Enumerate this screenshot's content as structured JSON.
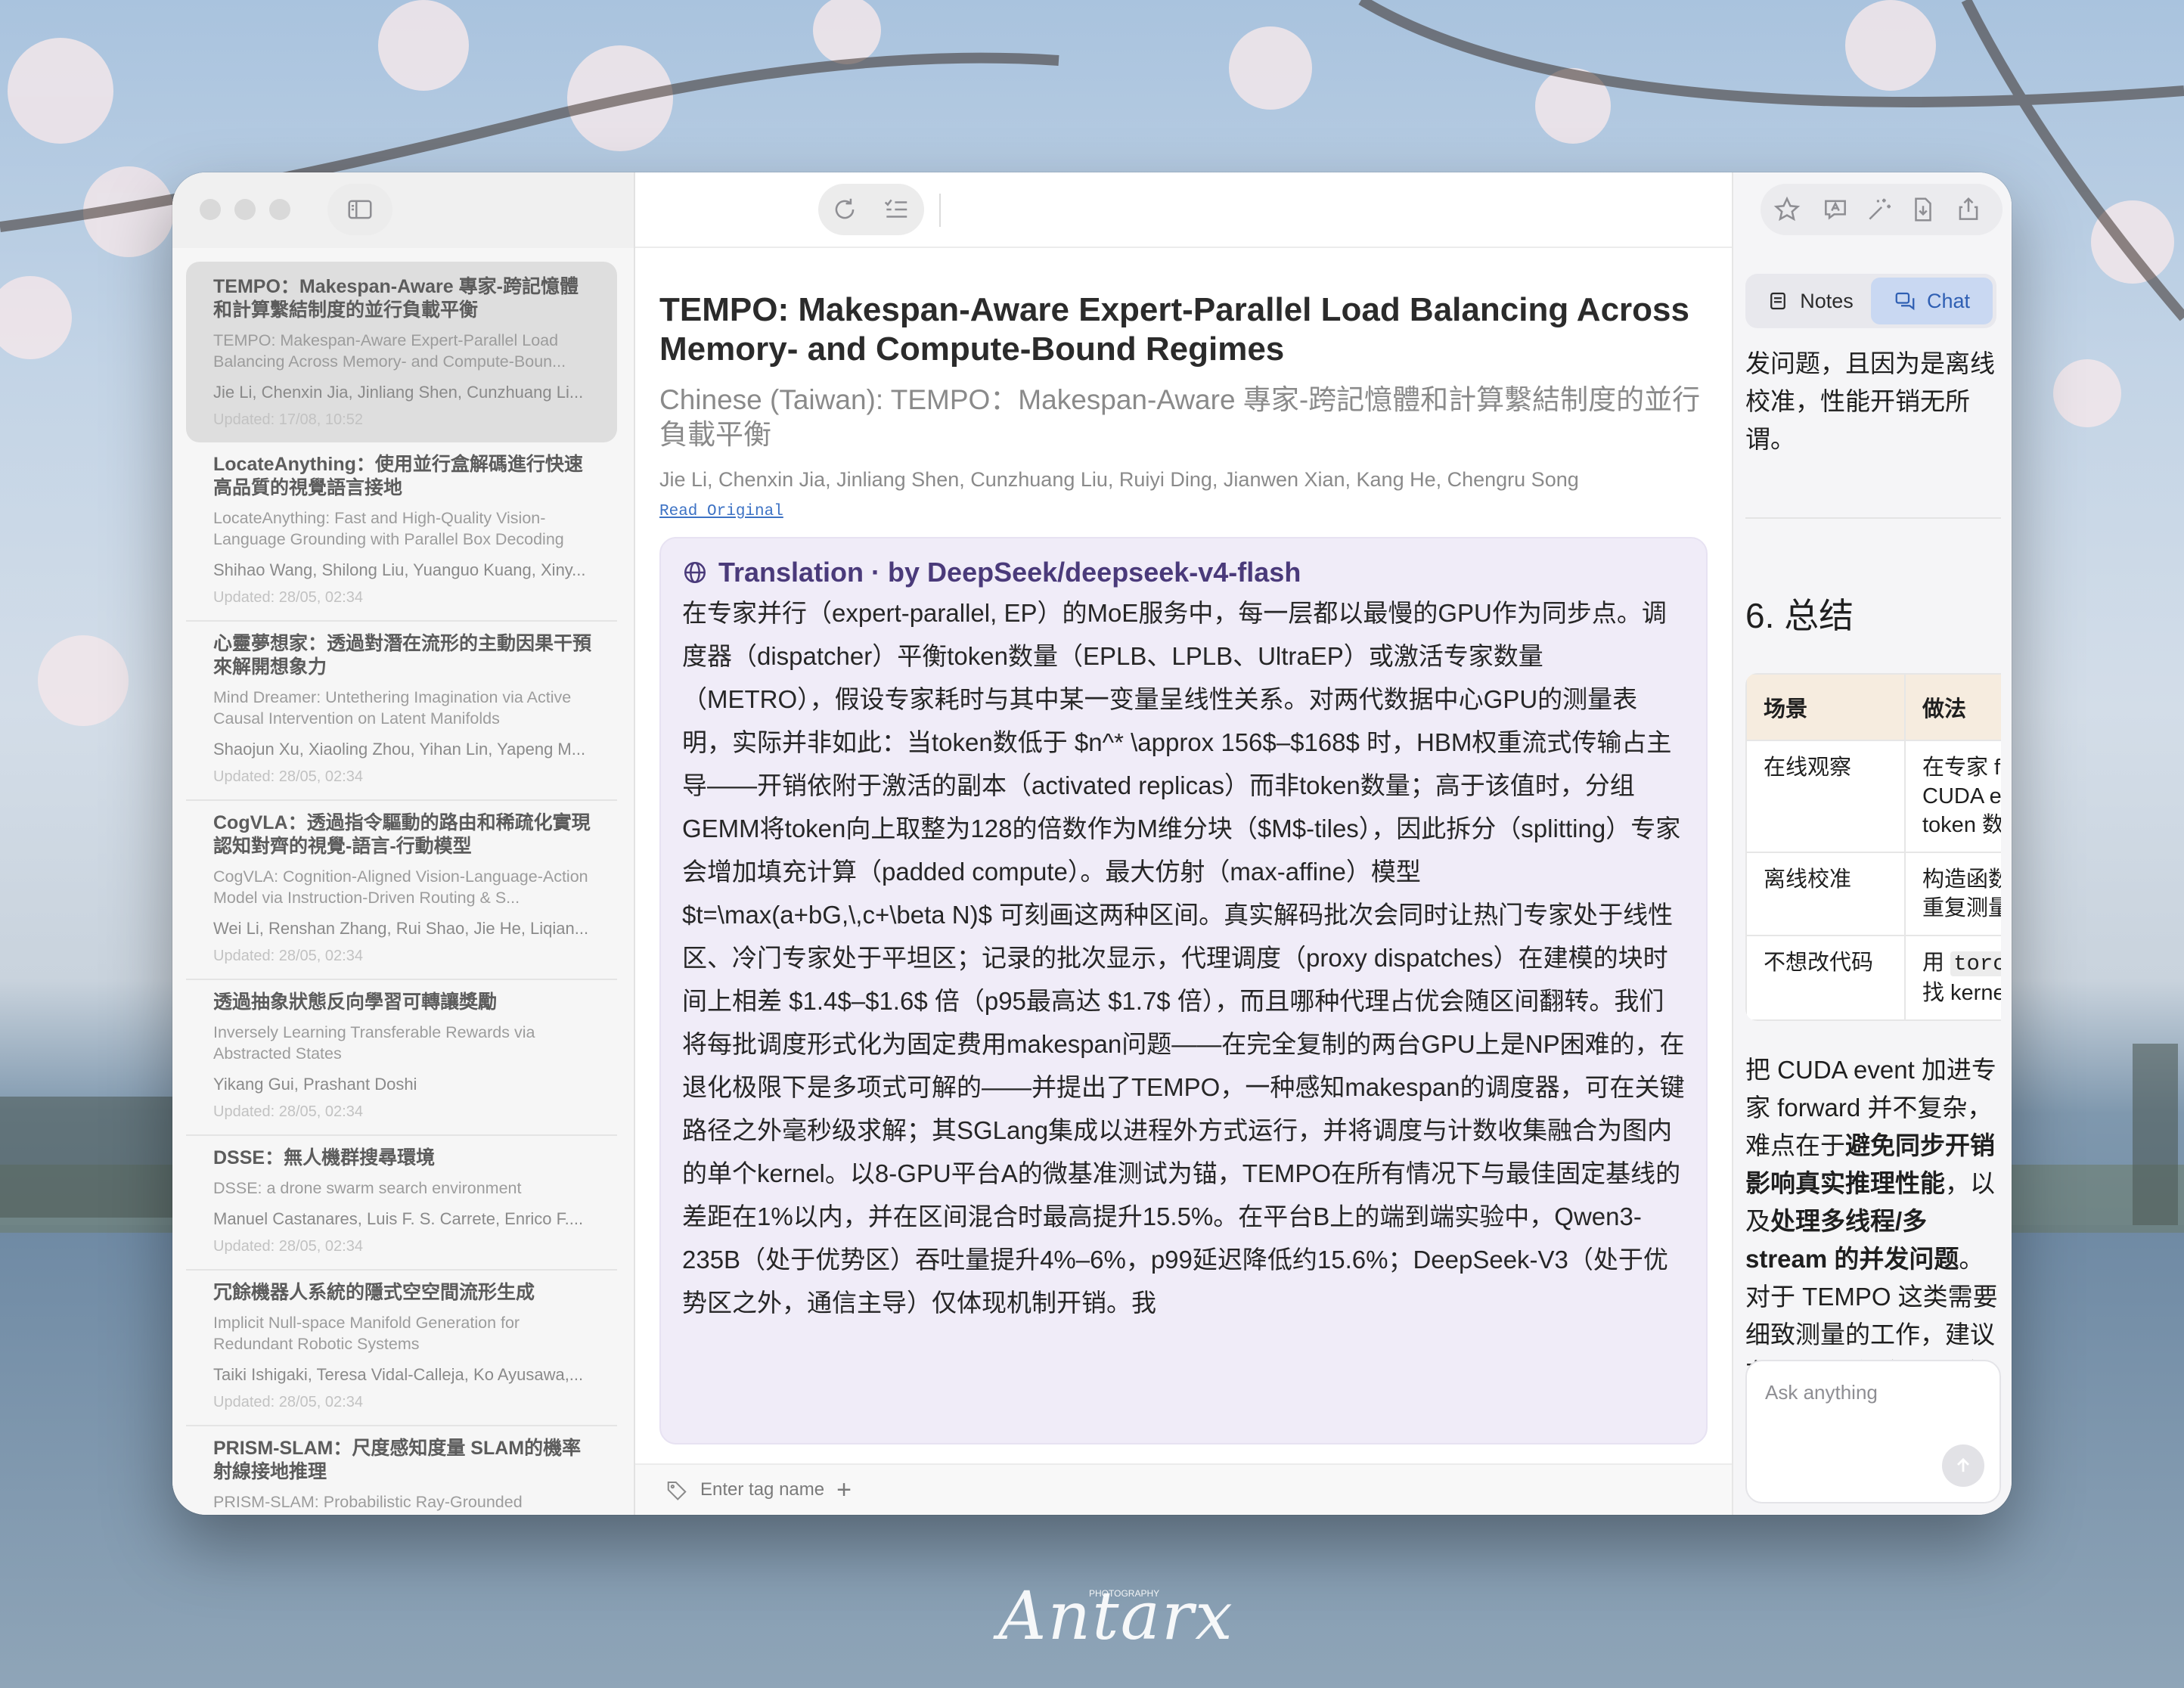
{
  "window": {
    "toolbar_icons": [
      "sidebar-toggle-icon",
      "refresh-icon",
      "checklist-icon",
      "star-icon",
      "translate-icon",
      "magic-wand-icon",
      "download-doc-icon",
      "share-icon",
      "right-panel-icon"
    ]
  },
  "sidebar": {
    "items": [
      {
        "title": "TEMPO：Makespan-Aware 專家-跨記憶體和計算繫結制度的並行負載平衡",
        "subtitle": "TEMPO: Makespan-Aware Expert-Parallel Load Balancing Across Memory- and Compute-Boun...",
        "authors": "Jie Li, Chenxin Jia, Jinliang Shen, Cunzhuang Li...",
        "updated": "Updated: 17/08, 10:52",
        "selected": true
      },
      {
        "title": "LocateAnything：使用並行盒解碼進行快速高品質的視覺語言接地",
        "subtitle": "LocateAnything: Fast and High-Quality Vision-Language Grounding with Parallel Box Decoding",
        "authors": "Shihao Wang, Shilong Liu, Yuanguo Kuang, Xiny...",
        "updated": "Updated: 28/05, 02:34",
        "selected": false
      },
      {
        "title": "心靈夢想家：透過對潛在流形的主動因果干預來解開想象力",
        "subtitle": "Mind Dreamer: Untethering Imagination via Active Causal Intervention on Latent Manifolds",
        "authors": "Shaojun Xu, Xiaoling Zhou, Yihan Lin, Yapeng M...",
        "updated": "Updated: 28/05, 02:34",
        "selected": false
      },
      {
        "title": "CogVLA：透過指令驅動的路由和稀疏化實現認知對齊的視覺-語言-行動模型",
        "subtitle": "CogVLA: Cognition-Aligned Vision-Language-Action Model via Instruction-Driven Routing & S...",
        "authors": "Wei Li, Renshan Zhang, Rui Shao, Jie He, Liqian...",
        "updated": "Updated: 28/05, 02:34",
        "selected": false
      },
      {
        "title": "透過抽象狀態反向學習可轉讓獎勵",
        "subtitle": "Inversely Learning Transferable Rewards via Abstracted States",
        "authors": "Yikang Gui, Prashant Doshi",
        "updated": "Updated: 28/05, 02:34",
        "selected": false
      },
      {
        "title": "DSSE：無人機群搜尋環境",
        "subtitle": "DSSE: a drone swarm search environment",
        "authors": "Manuel Castanares, Luis F. S. Carrete, Enrico F....",
        "updated": "Updated: 28/05, 02:34",
        "selected": false
      },
      {
        "title": "冗餘機器人系統的隱式空空間流形生成",
        "subtitle": "Implicit Null-space Manifold Generation for Redundant Robotic Systems",
        "authors": "Taiki Ishigaki, Teresa Vidal-Calleja, Ko Ayusawa,...",
        "updated": "Updated: 28/05, 02:34",
        "selected": false
      },
      {
        "title": "PRISM-SLAM：尺度感知度量 SLAM的機率射線接地推理",
        "subtitle": "PRISM-SLAM: Probabilistic Ray-Grounded Inference for Scale-aware Metric SLAM",
        "authors": "",
        "updated": "",
        "selected": false
      }
    ]
  },
  "paper": {
    "title": "TEMPO: Makespan-Aware Expert-Parallel Load Balancing Across Memory- and Compute-Bound Regimes",
    "translated_title": "Chinese (Taiwan): TEMPO：Makespan-Aware 專家-跨記憶體和計算繫結制度的並行負載平衡",
    "authors": "Jie Li, Chenxin Jia, Jinliang Shen, Cunzhuang Liu, Ruiyi Ding, Jianwen Xian, Kang He, Chengru Song",
    "read_original": "Read Original",
    "translation_header": "Translation · by DeepSeek/deepseek-v4-flash",
    "translation_body": "在专家并行（expert-parallel, EP）的MoE服务中，每一层都以最慢的GPU作为同步点。调度器（dispatcher）平衡token数量（EPLB、LPLB、UltraEP）或激活专家数量（METRO），假设专家耗时与其中某一变量呈线性关系。对两代数据中心GPU的测量表明，实际并非如此：当token数低于 $n^* \\approx 156$–$168$ 时，HBM权重流式传输占主导——开销依附于激活的副本（activated replicas）而非token数量；高于该值时，分组GEMM将token向上取整为128的倍数作为M维分块（$M$-tiles），因此拆分（splitting）专家会增加填充计算（padded compute）。最大仿射（max-affine）模型 $t=\\max(a+bG,\\,c+\\beta N)$ 可刻画这两种区间。真实解码批次会同时让热门专家处于线性区、冷门专家处于平坦区；记录的批次显示，代理调度（proxy dispatches）在建模的块时间上相差 $1.4$–$1.6$ 倍（p95最高达 $1.7$ 倍），而且哪种代理占优会随区间翻转。我们将每批调度形式化为固定费用makespan问题——在完全复制的两台GPU上是NP困难的，在退化极限下是多项式可解的——并提出了TEMPO，一种感知makespan的调度器，可在关键路径之外毫秒级求解；其SGLang集成以进程外方式运行，并将调度与计数收集融合为图内的单个kernel。以8-GPU平台A的微基准测试为锚，TEMPO在所有情况下与最佳固定基线的差距在1%以内，并在区间混合时最高提升15.5%。在平台B上的端到端实验中，Qwen3-235B（处于优势区）吞吐量提升4%–6%，p99延迟降低约15.6%；DeepSeek-V3（处于优势区之外，通信主导）仅体现机制开销。我"
  },
  "tagbar": {
    "placeholder": "Enter tag name"
  },
  "right": {
    "tabs": {
      "notes": "Notes",
      "chat": "Chat",
      "active": "chat"
    },
    "msg_intro": "发问题，且因为是离线校准，性能开销无所谓。",
    "section_heading": "6. 总结",
    "table": {
      "headers": [
        "场景",
        "做法"
      ],
      "rows": [
        {
          "scene": "在线观察",
          "method": "在专家 forward 内用两个 CUDA event 包裹，记录 token 数和耗时"
        },
        {
          "scene": "离线校准",
          "method": "构造函数输入，用 event 重复测量"
        },
        {
          "scene": "不想改代码",
          "method_pre": "用 ",
          "method_code": "torch.profiler",
          "method_post": " 找 kernel 和 input_shape"
        }
      ]
    },
    "summary": {
      "p1": "把 CUDA event 加进专家 forward 并不复杂，难点在于",
      "b1": "避免同步开销影响真实推理性能",
      "p2": "，以及",
      "b2": "处理多线程/多 stream 的并发问题",
      "p3": "。对于 TEMPO 这类需要细致测量的工作，建议在测试环境（非生产）中先开启，采集足够样本后立即关闭。"
    },
    "ask_placeholder": "Ask anything"
  },
  "watermark": {
    "text": "Antarx",
    "small": "PHOTOGRAPHY"
  }
}
